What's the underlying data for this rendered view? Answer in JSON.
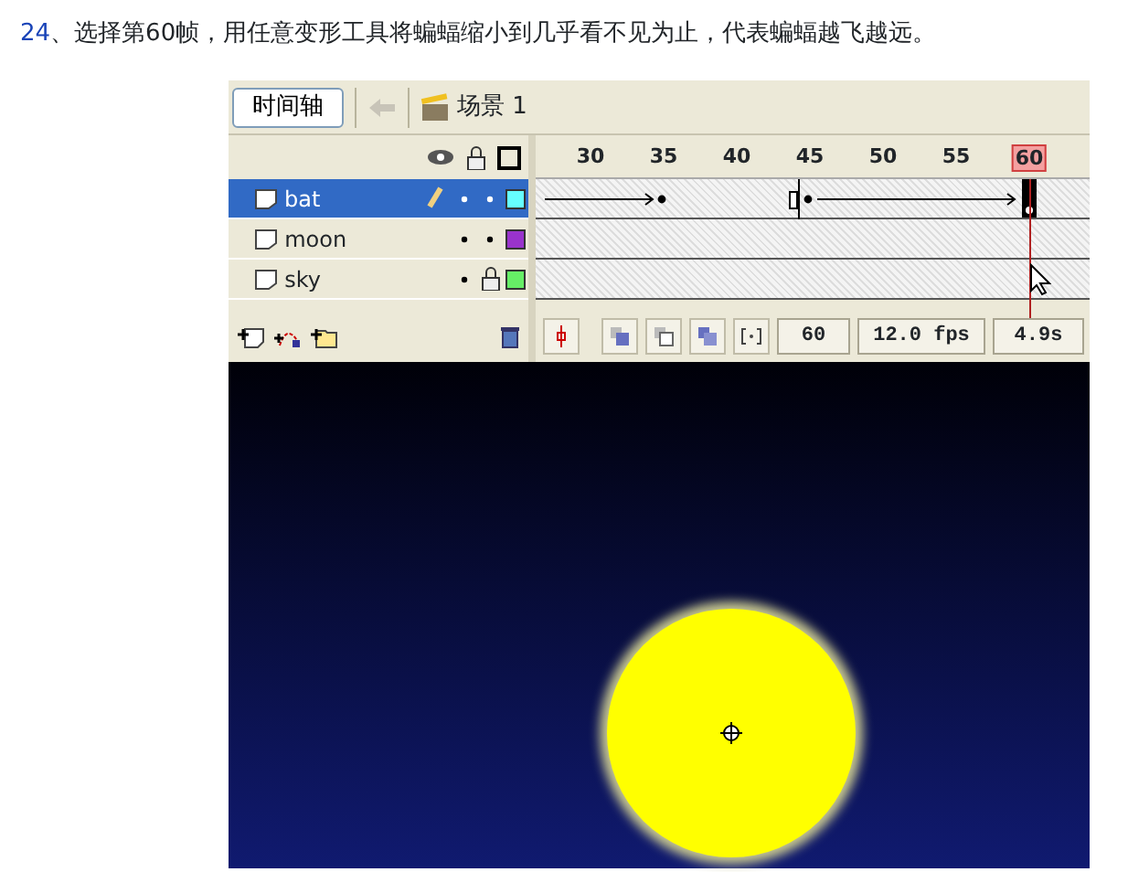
{
  "caption": {
    "number": "24",
    "text": "、选择第60帧，用任意变形工具将蝙蝠缩小到几乎看不见为止，代表蝙蝠越飞越远。"
  },
  "toolbar": {
    "timeline_button": "时间轴",
    "scene": "场景 1"
  },
  "ruler": {
    "labels": [
      {
        "text": "30",
        "selected": false
      },
      {
        "text": "35",
        "selected": false
      },
      {
        "text": "40",
        "selected": false
      },
      {
        "text": "45",
        "selected": false
      },
      {
        "text": "50",
        "selected": false
      },
      {
        "text": "55",
        "selected": false
      },
      {
        "text": "60",
        "selected": true
      }
    ]
  },
  "layers": [
    {
      "name": "bat",
      "selected": true,
      "editing": true,
      "locked": false,
      "color": "#66ffff"
    },
    {
      "name": "moon",
      "selected": false,
      "editing": false,
      "locked": false,
      "color": "#9933cc"
    },
    {
      "name": "sky",
      "selected": false,
      "editing": false,
      "locked": true,
      "color": "#66ee66"
    }
  ],
  "status": {
    "frame": "60",
    "fps": "12.0 fps",
    "time": "4.9s"
  }
}
